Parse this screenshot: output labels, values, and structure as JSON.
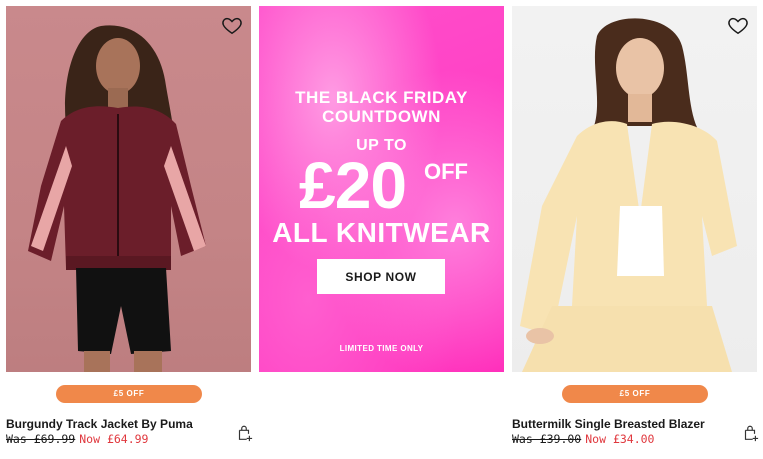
{
  "products": [
    {
      "badge": "£5 OFF",
      "title": "Burgundy Track Jacket By Puma",
      "was": "Was £69.99",
      "now": "Now £64.99"
    },
    {
      "badge": "£5 OFF",
      "title": "Buttermilk Single Breasted Blazer",
      "was": "Was £39.00",
      "now": "Now £34.00"
    }
  ],
  "promo": {
    "line1": "THE BLACK FRIDAY",
    "line2": "COUNTDOWN",
    "up_to": "UP TO",
    "amount": "£20",
    "off": "OFF",
    "headline": "ALL KNITWEAR",
    "button_label": "SHOP NOW",
    "footnote": "LIMITED TIME ONLY"
  },
  "icons": {
    "wishlist": "heart-outline-icon",
    "add_to_bag": "bag-plus-icon"
  },
  "colors": {
    "badge": "#f0884a",
    "sale_price": "#e0383e",
    "promo_pink": "#ff3ec4"
  }
}
